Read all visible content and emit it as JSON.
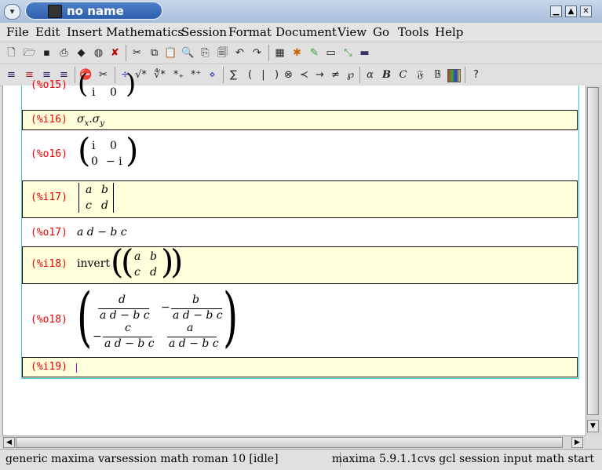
{
  "window": {
    "title": "no name"
  },
  "menu": [
    "File",
    "Edit",
    "Insert",
    "Mathematics",
    "Session",
    "Format",
    "Document",
    "View",
    "Go",
    "Tools",
    "Help"
  ],
  "toolbar1_icons": [
    "new-document-icon",
    "open-icon",
    "save-icon",
    "print-icon",
    "package-icon",
    "globe-icon",
    "close-icon",
    "cut-icon",
    "copy-icon",
    "paste-icon",
    "find-icon",
    "replace-icon",
    "spell-icon",
    "undo-icon",
    "redo-icon",
    "table-icon",
    "palette-icon",
    "draw-icon",
    "window-icon",
    "resize-icon",
    "screen-icon"
  ],
  "toolbar2": {
    "symbols": [
      "÷",
      "√*",
      "∜*",
      "*₊",
      "*⁺",
      "⋄",
      "∑",
      "(",
      "|",
      ")",
      "⊗",
      "≺",
      "→",
      "≠",
      "℘",
      "α",
      "B",
      "C",
      "𝔉",
      "𝔹",
      "?"
    ]
  },
  "session": {
    "o15": {
      "label": "(%o15)",
      "row": [
        "i",
        "0"
      ]
    },
    "i16": {
      "label": "(%i16)",
      "expr": "σ",
      "sub1": "x",
      "dot": ".",
      "sigma2": "σ",
      "sub2": "y"
    },
    "o16": {
      "label": "(%o16)",
      "r1": [
        "i",
        "0"
      ],
      "r2": [
        "0",
        "− i"
      ]
    },
    "i17": {
      "label": "(%i17)",
      "r1": [
        "a",
        "b"
      ],
      "r2": [
        "c",
        "d"
      ]
    },
    "o17": {
      "label": "(%o17)",
      "expr": "a d − b c"
    },
    "i18": {
      "label": "(%i18)",
      "fn": "invert",
      "r1": [
        "a",
        "b"
      ],
      "r2": [
        "c",
        "d"
      ]
    },
    "o18": {
      "label": "(%o18)",
      "n11": "d",
      "d11": "a d − b c",
      "s12": "−",
      "n12": "b",
      "d12": "a d − b c",
      "s21": "−",
      "n21": "c",
      "d21": "a d − b c",
      "n22": "a",
      "d22": "a d − b c"
    },
    "i19": {
      "label": "(%i19)"
    }
  },
  "status": {
    "left": "generic maxima varsession math roman 10 [idle]",
    "right": "maxima 5.9.1.1cvs gcl session input math start"
  }
}
